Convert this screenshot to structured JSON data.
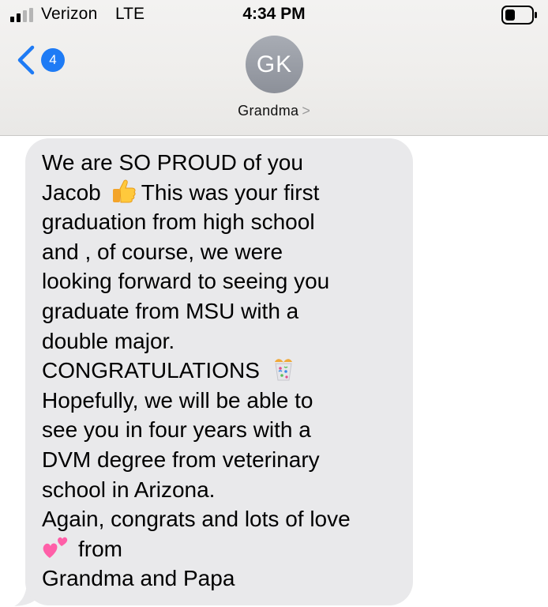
{
  "status_bar": {
    "carrier": "Verizon",
    "network": "LTE",
    "time": "4:34 PM"
  },
  "nav": {
    "back_badge": "4",
    "avatar_initials": "GK",
    "contact_name": "Grandma",
    "contact_chevron": ">"
  },
  "message": {
    "lines": [
      "We are SO PROUD of you",
      "Jacob",
      "This was your first",
      "graduation from high school",
      "and , of course, we were",
      "looking forward to seeing you",
      "graduate from MSU with a",
      "double major.",
      "CONGRATULATIONS",
      "Hopefully, we will be able to",
      "see you in four years with a",
      "DVM degree from veterinary",
      "school in Arizona.",
      "Again, congrats and lots of love",
      "from",
      "Grandma and Papa"
    ],
    "emojis": [
      "thumbs-up-emoji",
      "confetti-emoji",
      "two-hearts-emoji"
    ]
  },
  "colors": {
    "ios_blue": "#1e7bf5",
    "bubble_gray": "#e9e9eb",
    "avatar_gray": "#9a9ea6"
  }
}
